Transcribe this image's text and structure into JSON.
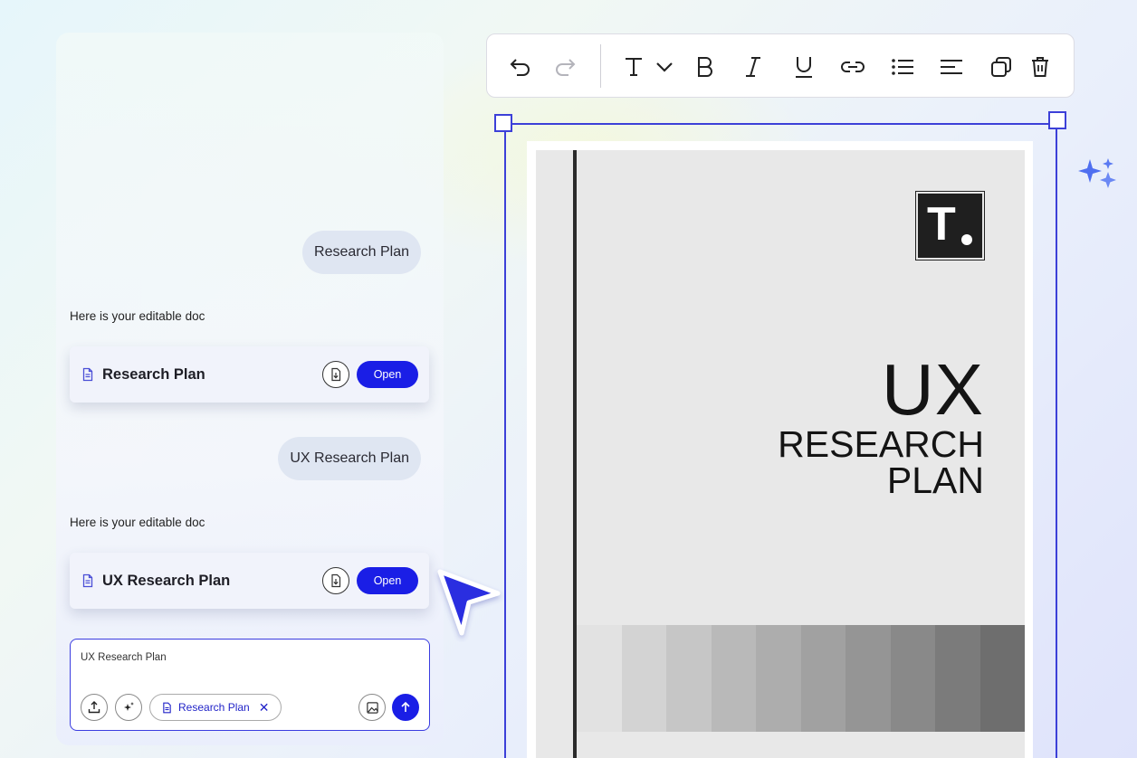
{
  "chat": {
    "messages": [
      {
        "role": "user",
        "text": "Research Plan"
      },
      {
        "role": "assistant",
        "text": "Here is your editable doc"
      },
      {
        "role": "user",
        "text": "UX Research Plan"
      },
      {
        "role": "assistant",
        "text": "Here is your editable doc"
      }
    ],
    "cards": [
      {
        "title": "Research Plan",
        "open_label": "Open",
        "icon": "document-icon"
      },
      {
        "title": "UX Research Plan",
        "open_label": "Open",
        "icon": "document-icon"
      }
    ],
    "composer": {
      "value": "UX Research Plan",
      "attachment_chip": "Research Plan"
    }
  },
  "toolbar": {
    "icons": [
      "undo-icon",
      "redo-icon",
      "text-style-icon",
      "chevron-down-icon",
      "bold-icon",
      "italic-icon",
      "underline-icon",
      "link-icon",
      "bulleted-list-icon",
      "align-left-icon",
      "duplicate-icon",
      "delete-icon"
    ]
  },
  "document": {
    "logo_letter": "T",
    "title_big": "UX",
    "title_line1": "RESEARCH",
    "title_line2": "PLAN",
    "swatches": [
      "#e2e2e2",
      "#d3d3d3",
      "#c6c6c6",
      "#b9b9b9",
      "#adadad",
      "#a1a1a1",
      "#959595",
      "#898989",
      "#7b7b7b",
      "#6e6e6e"
    ]
  },
  "colors": {
    "accent": "#1a1ee6",
    "selection": "#3c40d8"
  }
}
